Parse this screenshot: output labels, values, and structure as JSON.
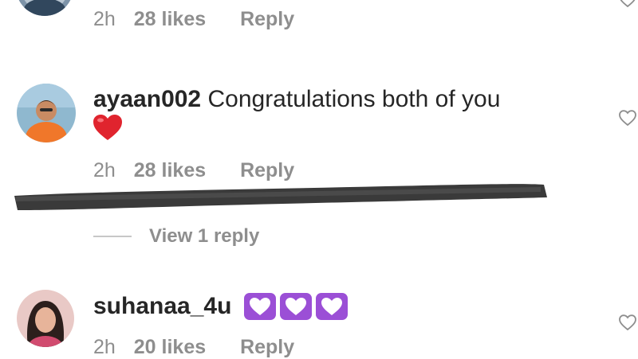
{
  "comments": [
    {
      "meta": {
        "time": "2h",
        "likes": "28 likes",
        "reply": "Reply"
      }
    },
    {
      "username": "ayaan002",
      "text": "Congratulations both of you",
      "emoji": "red-heart",
      "meta": {
        "time": "2h",
        "likes": "28 likes",
        "reply": "Reply"
      },
      "view_replies": "View 1 reply",
      "redacted": true
    },
    {
      "username": "suhanaa_4u",
      "emoji": "purple-heart x3",
      "meta": {
        "time": "2h",
        "likes": "20 likes",
        "reply": "Reply"
      }
    }
  ],
  "icons": {
    "like": "heart-outline-icon"
  },
  "colors": {
    "muted": "#8e8e8e",
    "text": "#262626",
    "red_heart": "#e0242e",
    "purple_heart": "#9b4fd6",
    "scribble": "#3a3a3a"
  }
}
